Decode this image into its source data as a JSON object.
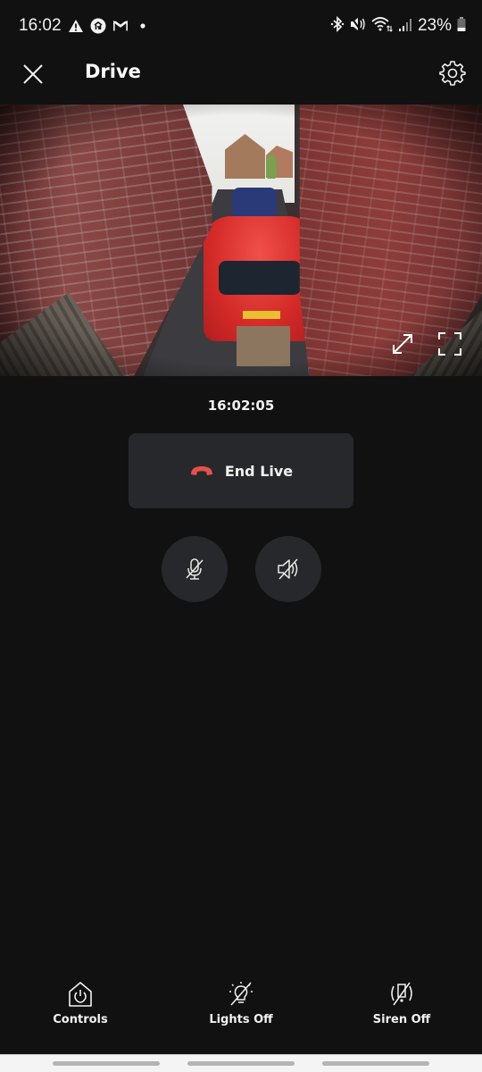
{
  "status_bar": {
    "time": "16:02",
    "left_icons": [
      "warning-icon",
      "app-notification-icon",
      "gmail-icon",
      "dot-icon"
    ],
    "right_icons": [
      "bluetooth-icon",
      "mute-icon",
      "wifi-icon",
      "signal-icon"
    ],
    "battery_percent": "23%"
  },
  "header": {
    "title": "Drive",
    "close_icon": "close-icon",
    "settings_icon": "gear-icon"
  },
  "camera": {
    "feed_description": "Live view of driveway between brick walls with red car",
    "expand_icon": "expand-arrows-icon",
    "fullscreen_icon": "fullscreen-icon"
  },
  "live": {
    "timestamp": "16:02:05",
    "end_live_label": "End Live",
    "end_live_icon_color": "#e8504a"
  },
  "audio": {
    "mic_state": "muted",
    "speaker_state": "muted"
  },
  "bottom_nav": {
    "items": [
      {
        "label": "Controls",
        "icon": "home-power-icon"
      },
      {
        "label": "Lights Off",
        "icon": "light-off-icon"
      },
      {
        "label": "Siren Off",
        "icon": "siren-off-icon"
      }
    ]
  }
}
